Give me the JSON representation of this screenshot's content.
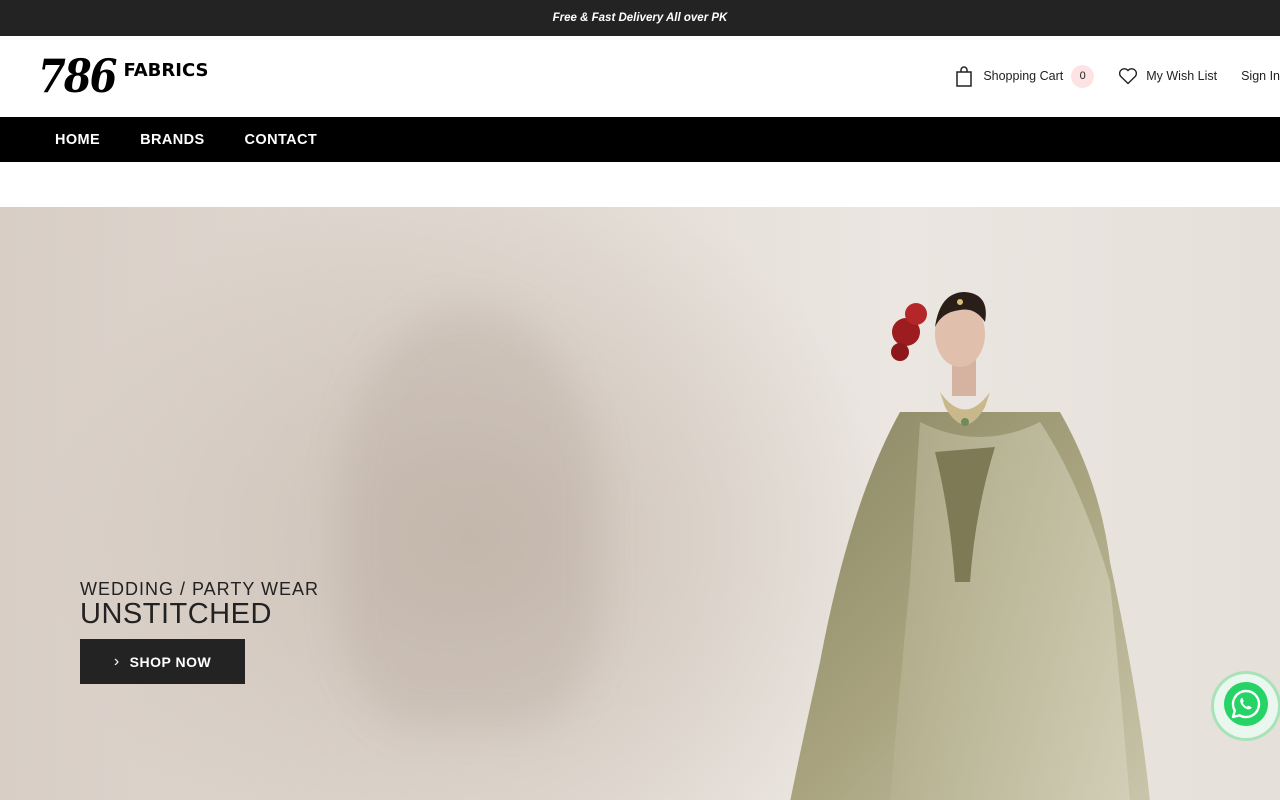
{
  "announcement": "Free & Fast Delivery All over PK",
  "logo": {
    "number": "786",
    "word": "FABRICS"
  },
  "header": {
    "cart_label": "Shopping Cart",
    "cart_count": "0",
    "wishlist_label": "My Wish List",
    "signin_label": "Sign In"
  },
  "nav": {
    "items": [
      {
        "label": "HOME"
      },
      {
        "label": "BRANDS"
      },
      {
        "label": "CONTACT"
      }
    ]
  },
  "hero": {
    "subtitle": "WEDDING / PARTY WEAR",
    "title": "UNSTITCHED",
    "button_label": "SHOP NOW"
  },
  "colors": {
    "topbar": "#232323",
    "nav": "#000000",
    "button": "#232323",
    "cart_badge": "#fde3e3",
    "whatsapp": "#25d366"
  },
  "icons": [
    "bag-icon",
    "heart-icon",
    "chevron-right-icon",
    "whatsapp-icon"
  ]
}
